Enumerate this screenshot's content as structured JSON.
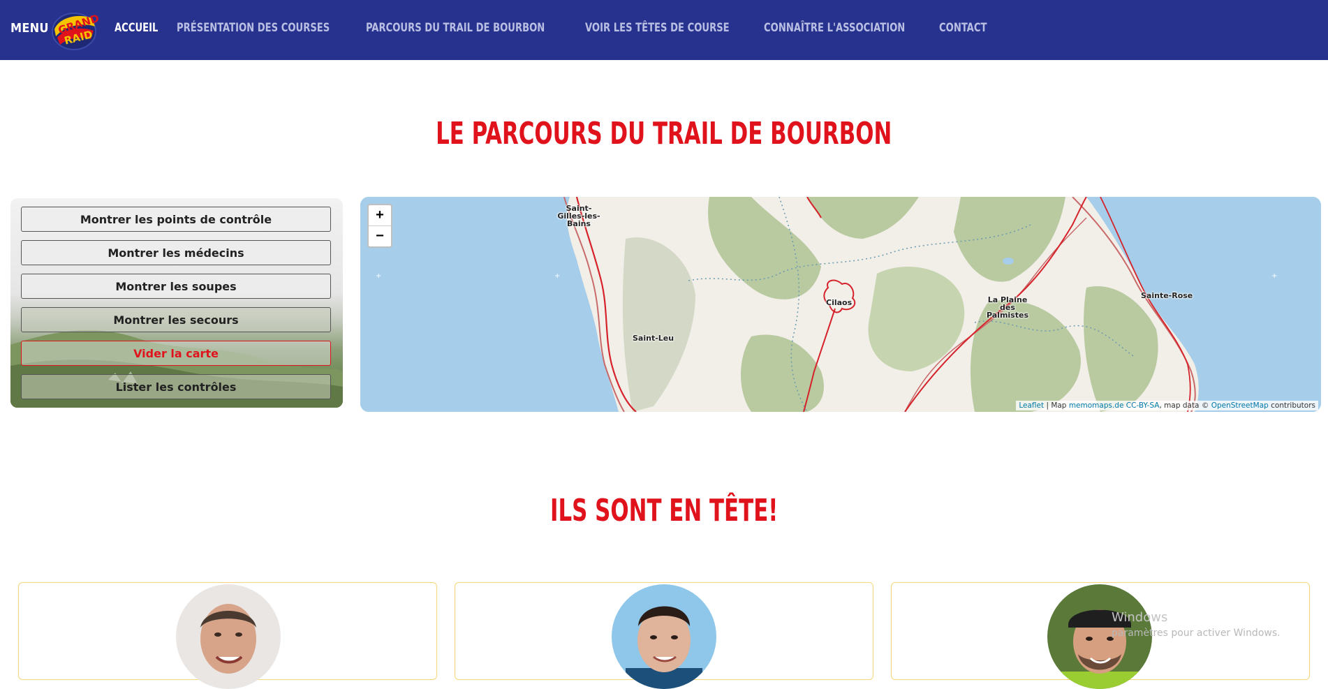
{
  "nav": {
    "menu_label": "MENU",
    "links": [
      {
        "label": "Accueil",
        "active": true
      },
      {
        "label": "Présentation des courses",
        "active": false
      },
      {
        "label": "Parcours du trail de Bourbon",
        "active": false
      },
      {
        "label": "Voir les têtes de course",
        "active": false
      },
      {
        "label": "Connaître l'association",
        "active": false
      },
      {
        "label": "Contact",
        "active": false
      }
    ]
  },
  "section_title": "Le parcours du trail de Bourbon",
  "controls": {
    "buttons": [
      "Montrer les points de contrôle",
      "Montrer les médecins",
      "Montrer les soupes",
      "Montrer les secours",
      "Vider la carte",
      "Lister les contrôles"
    ]
  },
  "map": {
    "zoom_in": "+",
    "zoom_out": "−",
    "places": [
      "Saint-Gilles-les-Bains",
      "Cilaos",
      "La Plaine des Palmistes",
      "Sainte-Rose",
      "Saint-Leu"
    ],
    "attribution": {
      "leaflet": "Leaflet",
      "sep1": "| Map",
      "memomaps": "memomaps.de",
      "license": "CC-BY-SA",
      "mapdata": ", map data ©",
      "osm": "OpenStreetMap",
      "contributors": "contributors"
    },
    "colors": {
      "sea": "#a6cde9",
      "land": "#f2efe9",
      "forest": "#b9c9a0",
      "route": "#d6222a"
    }
  },
  "leaders_title": "Ils sont en tête!",
  "watermark": {
    "line1": "Windows",
    "line2": "paramètres pour activer Windows."
  }
}
